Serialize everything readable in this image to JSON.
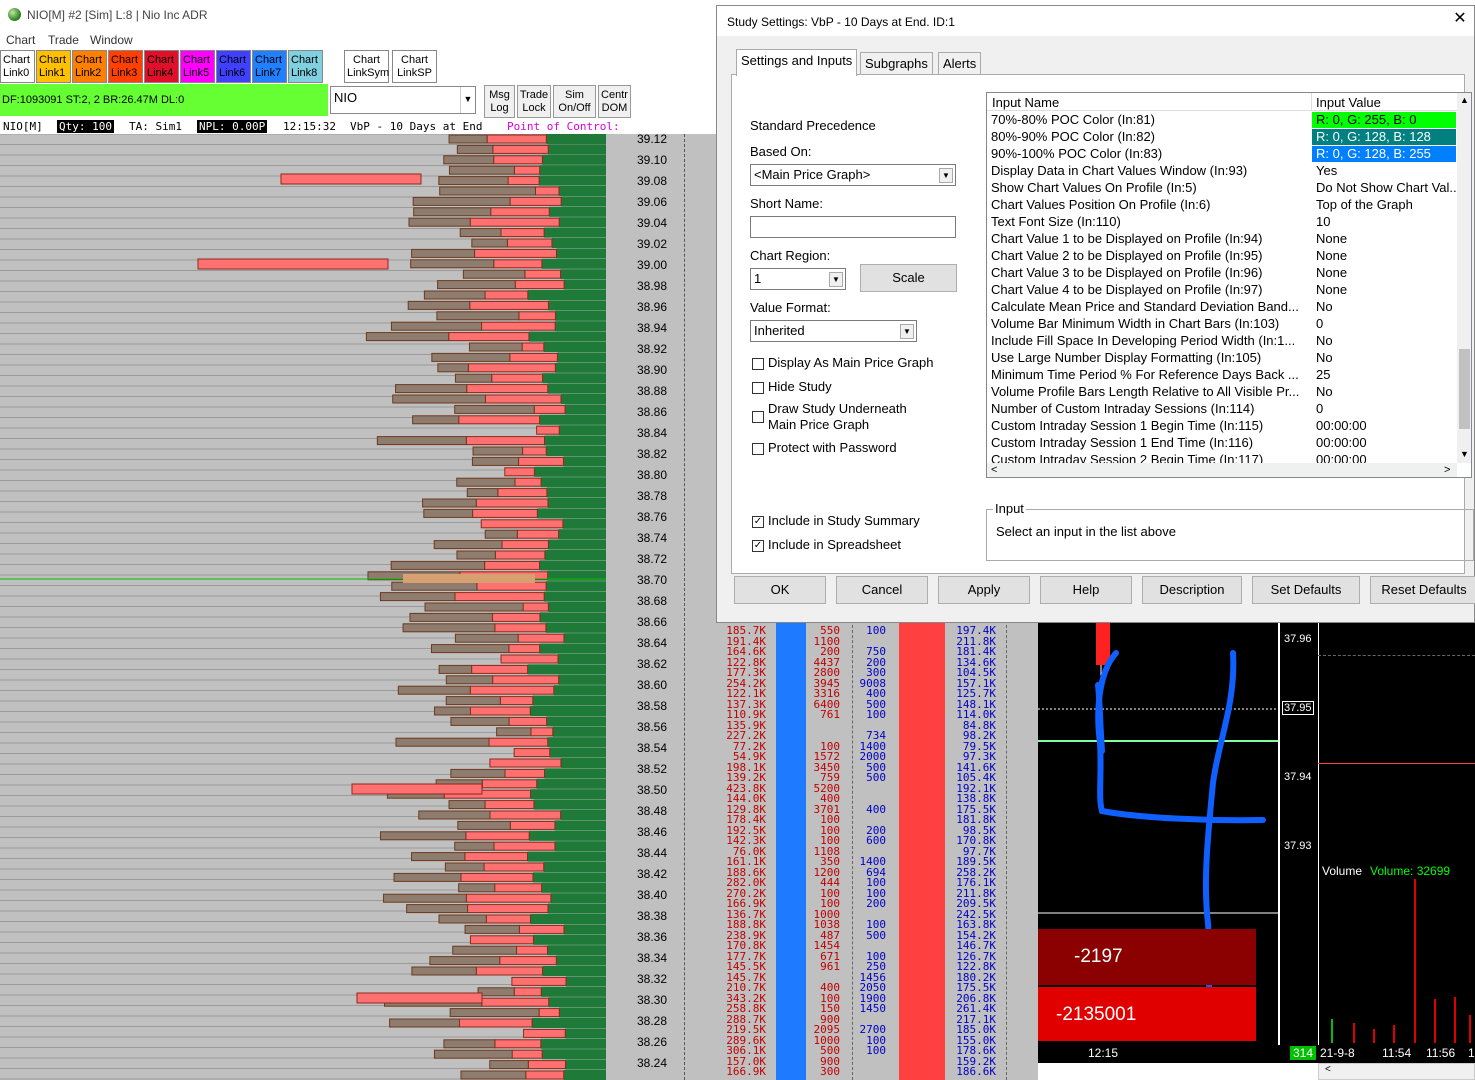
{
  "window": {
    "title": "NIO[M]  #2 [Sim]  L:8 | Nio Inc ADR",
    "menu": [
      "Chart",
      "Trade",
      "Window"
    ]
  },
  "link_buttons": [
    {
      "l1": "Chart",
      "l2": "Link0",
      "color": "#ffffff"
    },
    {
      "l1": "Chart",
      "l2": "Link1",
      "color": "#ffc000"
    },
    {
      "l1": "Chart",
      "l2": "Link2",
      "color": "#ff8000"
    },
    {
      "l1": "Chart",
      "l2": "Link3",
      "color": "#ff4000"
    },
    {
      "l1": "Chart",
      "l2": "Link4",
      "color": "#e0102a"
    },
    {
      "l1": "Chart",
      "l2": "Link5",
      "color": "#ff00ff"
    },
    {
      "l1": "Chart",
      "l2": "Link6",
      "color": "#4040ff"
    },
    {
      "l1": "Chart",
      "l2": "Link7",
      "color": "#2080ff"
    },
    {
      "l1": "Chart",
      "l2": "Link8",
      "color": "#80d0e0"
    }
  ],
  "link_sym": {
    "l1": "Chart",
    "l2": "LinkSym"
  },
  "link_sp": {
    "l1": "Chart",
    "l2": "LinkSP"
  },
  "toolbar_buttons": [
    {
      "l1": "Msg",
      "l2": "Log"
    },
    {
      "l1": "Trade",
      "l2": "Lock"
    },
    {
      "l1": "Sim",
      "l2": "On/Off"
    },
    {
      "l1": "Centr",
      "l2": "DOM"
    }
  ],
  "df_status": "DF:1093091  ST:2, 2  BR:26.47M  DL:0",
  "symbol": "NIO",
  "status_line": {
    "symbol": "NIO[M]",
    "qty": "Qty: 100",
    "ta": "TA: Sim1",
    "npl": "NPL: 0.00P",
    "time": "12:15:32",
    "study": "VbP - 10 Days at End",
    "poc": "Point of Control:"
  },
  "price_labels": [
    "39.12",
    "39.10",
    "39.08",
    "39.06",
    "39.04",
    "39.02",
    "39.00",
    "38.98",
    "38.96",
    "38.94",
    "38.92",
    "38.90",
    "38.88",
    "38.86",
    "38.84",
    "38.82",
    "38.80",
    "38.78",
    "38.76",
    "38.74",
    "38.72",
    "38.70",
    "38.68",
    "38.66",
    "38.64",
    "38.62",
    "38.60",
    "38.58",
    "38.56",
    "38.54",
    "38.52",
    "38.50",
    "38.48",
    "38.46",
    "38.44",
    "38.42",
    "38.40",
    "38.38",
    "38.36",
    "38.34",
    "38.32",
    "38.30",
    "38.28",
    "38.26",
    "38.24"
  ],
  "dom": {
    "col1": [
      "185.7K",
      "191.4K",
      "164.6K",
      "122.8K",
      "177.3K",
      "254.2K",
      "122.1K",
      "137.3K",
      "110.9K",
      "135.9K",
      "227.2K",
      "77.2K",
      "54.9K",
      "198.1K",
      "139.2K",
      "423.8K",
      "144.0K",
      "129.8K",
      "178.4K",
      "192.5K",
      "142.3K",
      "76.0K",
      "161.1K",
      "188.6K",
      "282.0K",
      "270.2K",
      "166.9K",
      "136.7K",
      "188.8K",
      "238.9K",
      "170.8K",
      "177.7K",
      "145.5K",
      "145.7K",
      "210.7K",
      "343.2K",
      "258.8K",
      "288.7K",
      "219.5K",
      "289.6K",
      "306.1K",
      "157.0K",
      "166.9K"
    ],
    "col2": [
      "550",
      "1100",
      "200",
      "4437",
      "2800",
      "3945",
      "3316",
      "6400",
      "761",
      "",
      "",
      "100",
      "1572",
      "3450",
      "759",
      "5200",
      "400",
      "3701",
      "100",
      "100",
      "100",
      "1108",
      "350",
      "1200",
      "444",
      "100",
      "100",
      "1000",
      "1038",
      "487",
      "1454",
      "671",
      "961",
      "",
      "400",
      "100",
      "150",
      "900",
      "2095",
      "1000",
      "500",
      "900",
      "300"
    ],
    "col3": [
      "100",
      "",
      "750",
      "200",
      "300",
      "9008",
      "400",
      "500",
      "100",
      "",
      "734",
      "1400",
      "2000",
      "500",
      "500",
      "",
      "",
      "400",
      "",
      "200",
      "600",
      "",
      "1400",
      "694",
      "100",
      "100",
      "200",
      "",
      "100",
      "500",
      "",
      "100",
      "250",
      "1456",
      "2050",
      "1900",
      "1450",
      "",
      "2700",
      "100",
      "100",
      "",
      ""
    ],
    "col4": [
      "197.4K",
      "211.8K",
      "181.4K",
      "134.6K",
      "104.5K",
      "157.1K",
      "125.7K",
      "148.1K",
      "114.0K",
      "84.8K",
      "98.2K",
      "79.5K",
      "97.3K",
      "141.6K",
      "105.4K",
      "192.1K",
      "138.8K",
      "175.5K",
      "181.8K",
      "98.5K",
      "170.8K",
      "97.7K",
      "189.5K",
      "258.2K",
      "176.1K",
      "211.8K",
      "209.5K",
      "242.5K",
      "163.8K",
      "154.2K",
      "146.7K",
      "126.7K",
      "122.8K",
      "180.2K",
      "175.5K",
      "206.8K",
      "261.4K",
      "217.1K",
      "185.0K",
      "155.0K",
      "178.6K",
      "159.2K",
      "186.6K"
    ]
  },
  "right_chart": {
    "scale": [
      "37.96",
      "37.95",
      "37.94",
      "37.93"
    ],
    "box1": "-2197",
    "box2": "-2135001",
    "time": "12:15",
    "badge": "314",
    "vol_label": "Volume",
    "vol_value": "Volume: 32699",
    "dates": [
      "21-9-8",
      "11:54",
      "11:56",
      "1"
    ],
    "hand_drawn_text": "L"
  },
  "dialog": {
    "title": "Study Settings: VbP - 10 Days at End. ID:1",
    "tabs": [
      "Settings and Inputs",
      "Subgraphs",
      "Alerts"
    ],
    "standard_precedence": "Standard Precedence",
    "based_on_label": "Based On:",
    "based_on_value": "<Main Price Graph>",
    "short_name_label": "Short Name:",
    "short_name_value": "",
    "chart_region_label": "Chart Region:",
    "chart_region_value": "1",
    "scale_button": "Scale",
    "value_format_label": "Value Format:",
    "value_format_value": "Inherited",
    "checkboxes": [
      {
        "label": "Display As Main Price Graph",
        "checked": false
      },
      {
        "label": "Hide Study",
        "checked": false
      },
      {
        "label": "Draw Study Underneath",
        "label2": "Main Price Graph",
        "checked": false
      },
      {
        "label": "Protect with Password",
        "checked": false
      }
    ],
    "checkboxes2": [
      {
        "label": "Include in Study Summary",
        "checked": true
      },
      {
        "label": "Include in Spreadsheet",
        "checked": true
      }
    ],
    "grid_headers": [
      "Input Name",
      "Input Value"
    ],
    "inputs": [
      {
        "name": "70%-80% POC Color  (In:81)",
        "value": "R: 0, G: 255, B: 0",
        "bg": "#00ff00",
        "fg": "#000000"
      },
      {
        "name": "80%-90% POC Color  (In:82)",
        "value": "R: 0, G: 128, B: 128",
        "bg": "#008080",
        "fg": "#ffffff"
      },
      {
        "name": "90%-100% POC Color  (In:83)",
        "value": "R: 0, G: 128, B: 255",
        "bg": "#0080ff",
        "fg": "#ffffff"
      },
      {
        "name": "Display Data in Chart Values Window  (In:93)",
        "value": "Yes"
      },
      {
        "name": "Show Chart Values On Profile  (In:5)",
        "value": "Do Not Show Chart Val..."
      },
      {
        "name": "Chart Values Position On Profile  (In:6)",
        "value": "Top of the Graph"
      },
      {
        "name": "Text Font Size  (In:110)",
        "value": "10"
      },
      {
        "name": "Chart Value 1 to be Displayed on Profile  (In:94)",
        "value": "None"
      },
      {
        "name": "Chart Value 2 to be Displayed on Profile  (In:95)",
        "value": "None"
      },
      {
        "name": "Chart Value 3 to be Displayed on Profile  (In:96)",
        "value": "None"
      },
      {
        "name": "Chart Value 4 to be Displayed on Profile  (In:97)",
        "value": "None"
      },
      {
        "name": "Calculate Mean Price and Standard Deviation Band...",
        "value": "No"
      },
      {
        "name": "Volume Bar Minimum Width in Chart Bars  (In:103)",
        "value": "0"
      },
      {
        "name": "Include Fill Space In Developing Period Width  (In:1...",
        "value": "No"
      },
      {
        "name": "Use Large Number Display Formatting  (In:105)",
        "value": "No"
      },
      {
        "name": "Minimum Time Period % For Reference Days Back ...",
        "value": "25"
      },
      {
        "name": "Volume Profile Bars Length Relative to All Visible Pr...",
        "value": "No"
      },
      {
        "name": "Number of Custom Intraday Sessions  (In:114)",
        "value": "0"
      },
      {
        "name": "Custom Intraday Session 1 Begin Time  (In:115)",
        "value": "00:00:00"
      },
      {
        "name": "Custom Intraday Session 1 End Time  (In:116)",
        "value": "00:00:00"
      },
      {
        "name": "Custom Intraday Session 2 Begin Time  (In:117)",
        "value": "00:00:00"
      }
    ],
    "input_group_label": "Input",
    "input_hint": "Select an input in the list above",
    "buttons": [
      "OK",
      "Cancel",
      "Apply",
      "Help",
      "Description",
      "Set Defaults",
      "Reset Defaults"
    ]
  }
}
